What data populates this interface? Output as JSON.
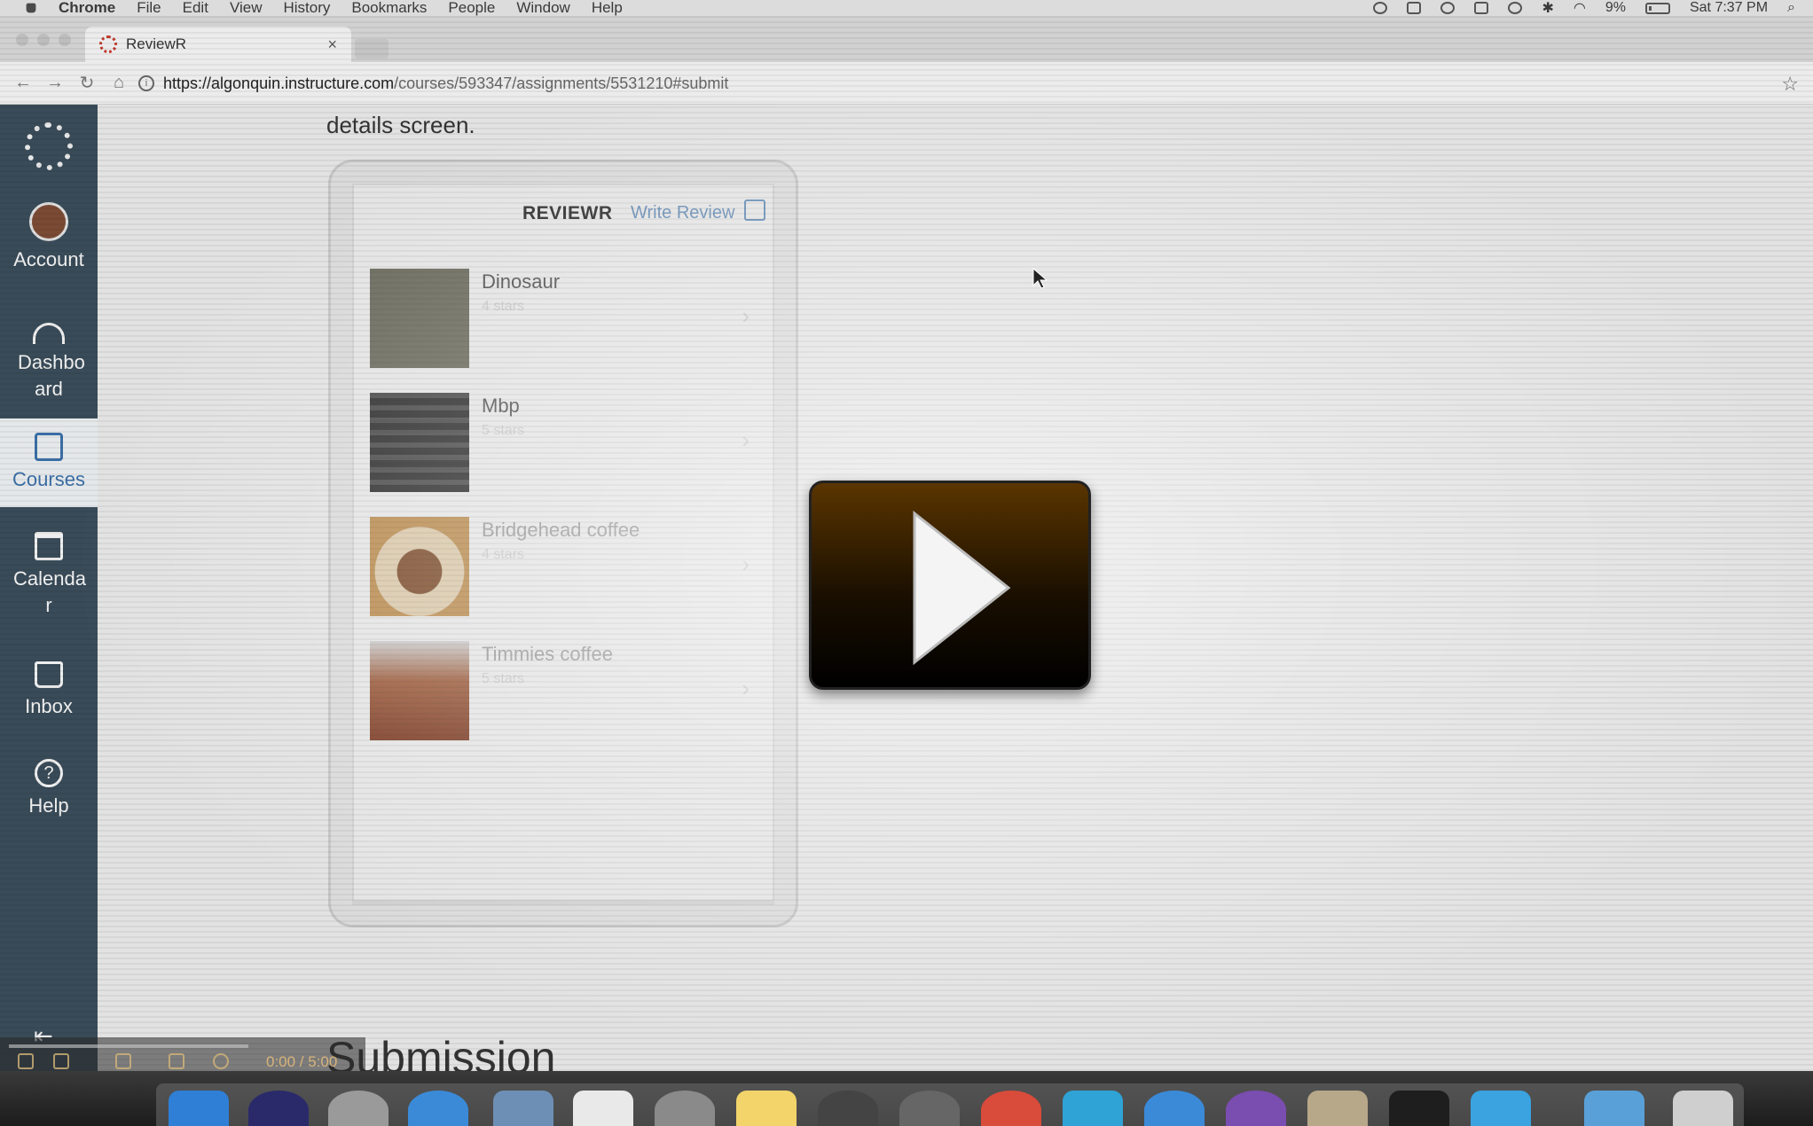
{
  "menubar": {
    "app": "Chrome",
    "items": [
      "File",
      "Edit",
      "View",
      "History",
      "Bookmarks",
      "People",
      "Window",
      "Help"
    ],
    "battery": "9%",
    "clock": "Sat 7:37 PM"
  },
  "browser": {
    "tab_title": "ReviewR",
    "tab_close": "×",
    "url_host": "https://algonquin.instructure.com",
    "url_path": "/courses/593347/assignments/5531210#submit"
  },
  "canvas_nav": {
    "account": "Account",
    "dashboard": "Dashbo ard",
    "courses": "Courses",
    "calendar": "Calenda r",
    "inbox": "Inbox",
    "help": "Help"
  },
  "content": {
    "details_text": "details screen.",
    "submission_heading": "Submission"
  },
  "app": {
    "title": "REVIEWR",
    "write_review": "Write Review",
    "reviews": [
      {
        "name": "Dinosaur",
        "stars": "4 stars",
        "thumb_color": "#6b6b5e"
      },
      {
        "name": "Mbp",
        "stars": "5 stars",
        "thumb_color": "#3f3f3f"
      },
      {
        "name": "Bridgehead coffee",
        "stars": "4 stars",
        "thumb_color": "#b88a4e"
      },
      {
        "name": "Timmies coffee",
        "stars": "5 stars",
        "thumb_color": "#9a5a3a"
      }
    ]
  },
  "video": {
    "time": "0:00 / 5:00",
    "accent": "#5a3500"
  }
}
